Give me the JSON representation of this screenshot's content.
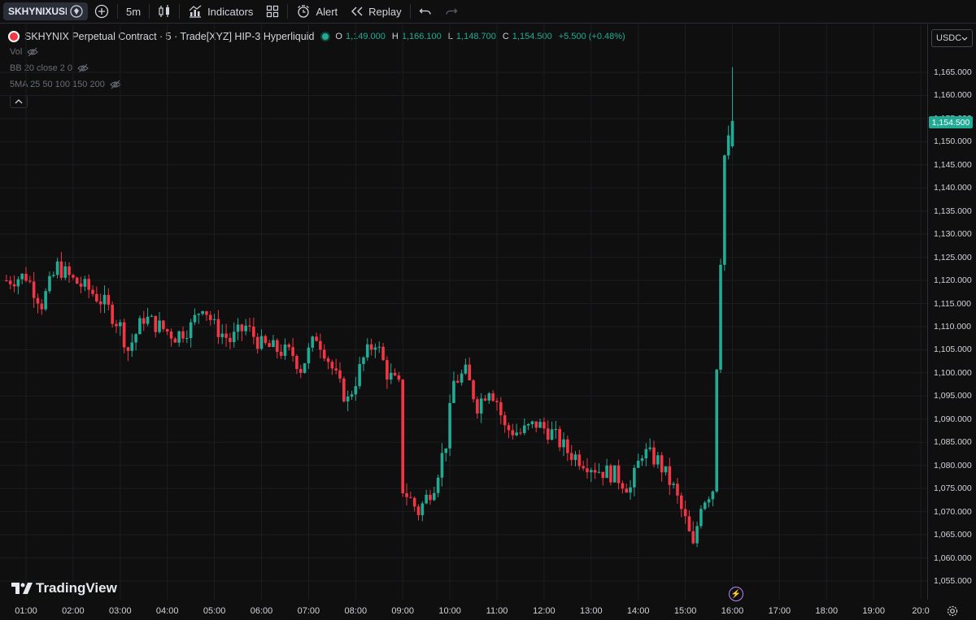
{
  "toolbar": {
    "symbol": "SKHYNIXUSDC",
    "interval": "5m",
    "indicators_label": "Indicators",
    "alert_label": "Alert",
    "replay_label": "Replay"
  },
  "legend": {
    "title": "SKHYNIX Perpetual Contract · 5 · Trade[XYZ] HIP-3 Hyperliquid",
    "o_key": "O",
    "o_val": "1,149.000",
    "h_key": "H",
    "h_val": "1,166.100",
    "l_key": "L",
    "l_val": "1,148.700",
    "c_key": "C",
    "c_val": "1,154.500",
    "change": "+5.500 (+0.48%)"
  },
  "indicators": {
    "vol": "Vol",
    "bb": "BB 20 close 2 0",
    "ma": "5MA 25 50 100 150 200"
  },
  "currency": "USDC",
  "last_price_label": "1,154.500",
  "branding": "TradingView",
  "colors": {
    "up": "#22ab94",
    "down": "#f23645",
    "background": "#0f0f0f",
    "grid": "#1b1d22"
  },
  "chart_data": {
    "type": "candlestick",
    "y_ticks": [
      "1,165.000",
      "1,160.000",
      "1,155.000",
      "1,150.000",
      "1,145.000",
      "1,140.000",
      "1,135.000",
      "1,130.000",
      "1,125.000",
      "1,120.000",
      "1,115.000",
      "1,110.000",
      "1,105.000",
      "1,100.000",
      "1,095.000",
      "1,090.000",
      "1,085.000",
      "1,080.000",
      "1,075.000",
      "1,070.000",
      "1,065.000",
      "1,060.000",
      "1,055.000"
    ],
    "y_tick_values": [
      1165,
      1160,
      1155,
      1150,
      1145,
      1140,
      1135,
      1130,
      1125,
      1120,
      1115,
      1110,
      1105,
      1100,
      1095,
      1090,
      1085,
      1080,
      1075,
      1070,
      1065,
      1060,
      1055
    ],
    "x_ticks": [
      "01:00",
      "02:00",
      "03:00",
      "04:00",
      "05:00",
      "06:00",
      "07:00",
      "08:00",
      "09:00",
      "10:00",
      "11:00",
      "12:00",
      "13:00",
      "14:00",
      "15:00",
      "16:00",
      "17:00",
      "18:00",
      "19:00",
      "20:0"
    ],
    "close_path": [
      {
        "t": "00:35",
        "c": 1120
      },
      {
        "t": "01:00",
        "c": 1121
      },
      {
        "t": "01:20",
        "c": 1115
      },
      {
        "t": "01:40",
        "c": 1123
      },
      {
        "t": "02:00",
        "c": 1120
      },
      {
        "t": "02:20",
        "c": 1118
      },
      {
        "t": "02:40",
        "c": 1115
      },
      {
        "t": "03:00",
        "c": 1110
      },
      {
        "t": "03:10",
        "c": 1105
      },
      {
        "t": "03:30",
        "c": 1112
      },
      {
        "t": "03:50",
        "c": 1110
      },
      {
        "t": "04:10",
        "c": 1108
      },
      {
        "t": "04:30",
        "c": 1110
      },
      {
        "t": "04:45",
        "c": 1115
      },
      {
        "t": "05:00",
        "c": 1110
      },
      {
        "t": "05:20",
        "c": 1107
      },
      {
        "t": "05:40",
        "c": 1110
      },
      {
        "t": "06:00",
        "c": 1106
      },
      {
        "t": "06:20",
        "c": 1105
      },
      {
        "t": "06:40",
        "c": 1104
      },
      {
        "t": "06:50",
        "c": 1101
      },
      {
        "t": "07:10",
        "c": 1108
      },
      {
        "t": "07:20",
        "c": 1105
      },
      {
        "t": "07:40",
        "c": 1097
      },
      {
        "t": "07:50",
        "c": 1094
      },
      {
        "t": "08:10",
        "c": 1103
      },
      {
        "t": "08:25",
        "c": 1107
      },
      {
        "t": "08:40",
        "c": 1100
      },
      {
        "t": "08:55",
        "c": 1097
      },
      {
        "t": "09:00",
        "c": 1075
      },
      {
        "t": "09:20",
        "c": 1070
      },
      {
        "t": "09:40",
        "c": 1076
      },
      {
        "t": "09:55",
        "c": 1085
      },
      {
        "t": "10:05",
        "c": 1098
      },
      {
        "t": "10:20",
        "c": 1100
      },
      {
        "t": "10:35",
        "c": 1093
      },
      {
        "t": "10:50",
        "c": 1097
      },
      {
        "t": "11:00",
        "c": 1094
      },
      {
        "t": "11:10",
        "c": 1088
      },
      {
        "t": "11:30",
        "c": 1087
      },
      {
        "t": "11:50",
        "c": 1089
      },
      {
        "t": "12:10",
        "c": 1087
      },
      {
        "t": "12:30",
        "c": 1083
      },
      {
        "t": "12:50",
        "c": 1081
      },
      {
        "t": "13:10",
        "c": 1079
      },
      {
        "t": "13:30",
        "c": 1078
      },
      {
        "t": "13:50",
        "c": 1075
      },
      {
        "t": "14:05",
        "c": 1083
      },
      {
        "t": "14:25",
        "c": 1081
      },
      {
        "t": "14:45",
        "c": 1075
      },
      {
        "t": "15:00",
        "c": 1068
      },
      {
        "t": "15:10",
        "c": 1062
      },
      {
        "t": "15:20",
        "c": 1072
      },
      {
        "t": "15:35",
        "c": 1075
      },
      {
        "t": "15:40",
        "c": 1102
      },
      {
        "t": "15:45",
        "c": 1125
      },
      {
        "t": "15:50",
        "c": 1147
      },
      {
        "t": "15:55",
        "c": 1150
      },
      {
        "t": "16:00",
        "c": 1154.5
      }
    ],
    "last": {
      "o": 1149.0,
      "h": 1166.1,
      "l": 1148.7,
      "c": 1154.5
    },
    "grid": true
  }
}
